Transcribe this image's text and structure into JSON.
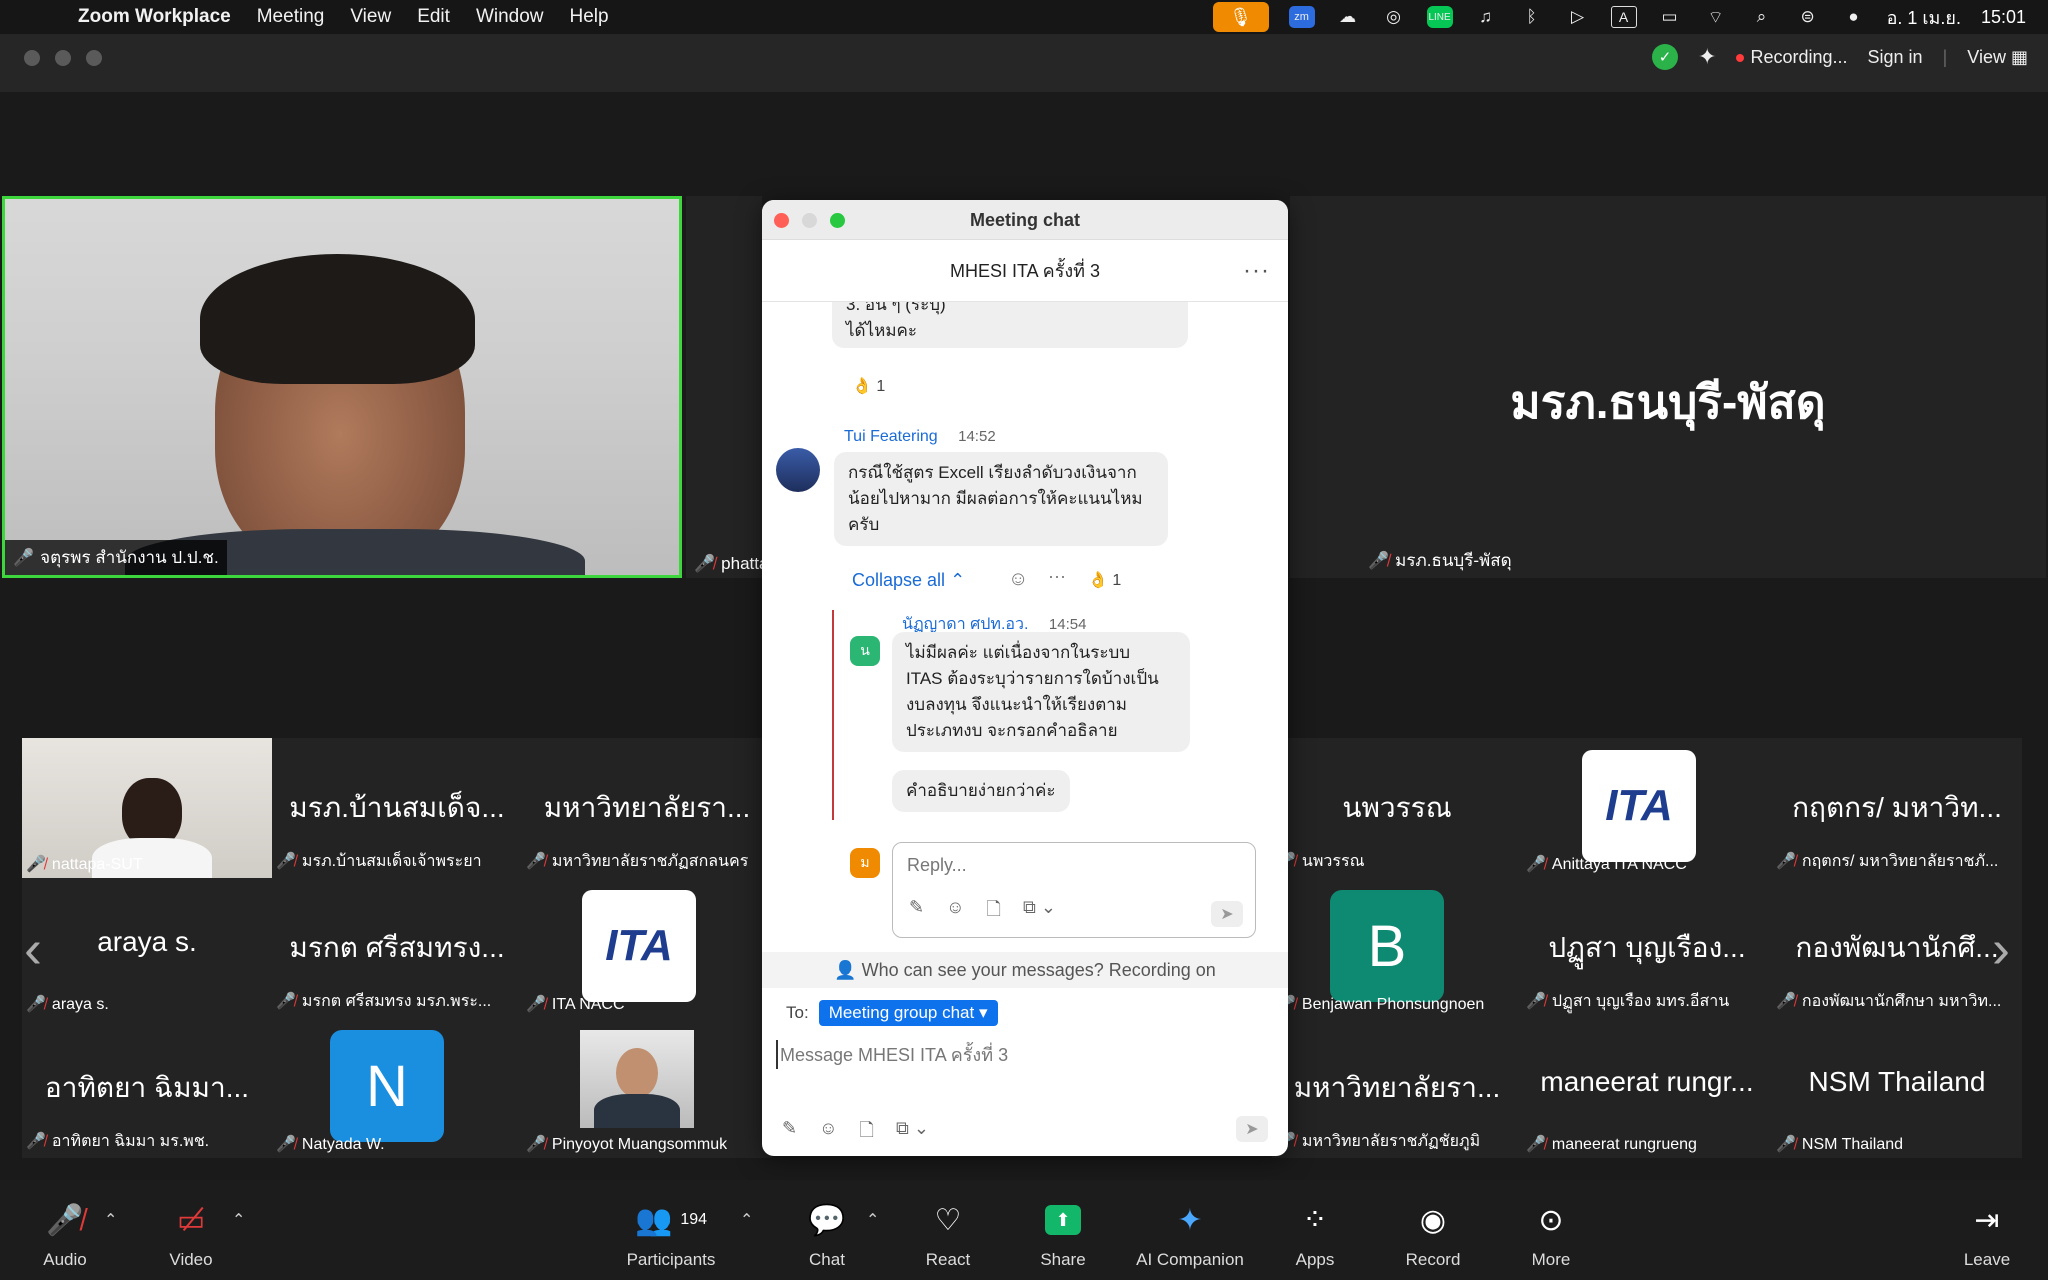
{
  "menubar": {
    "app": "Zoom Workplace",
    "items": [
      "Meeting",
      "View",
      "Edit",
      "Window",
      "Help"
    ],
    "date": "อ. 1 เม.ย.",
    "time": "15:01"
  },
  "titlebar": {
    "recording": "Recording...",
    "sign_in": "Sign in",
    "view": "View"
  },
  "main_video": {
    "name": "จตุรพร สำนักงาน ป.ป.ช."
  },
  "big_tiles": [
    {
      "name": "phatta",
      "center": ""
    },
    {
      "name": "มรภ.ธนบุรี-พัสดุ",
      "center": "มรภ.ธนบุรี-พัสดุ"
    }
  ],
  "grid": {
    "row1": [
      {
        "center": "",
        "name": "nattapa-SUT",
        "kind": "photo-woman"
      },
      {
        "center": "มรภ.บ้านสมเด็จ...",
        "name": "มรภ.บ้านสมเด็จเจ้าพระยา"
      },
      {
        "center": "มหาวิทยาลัยรา...",
        "name": "มหาวิทยาลัยราชภัฏสกลนคร"
      },
      {
        "center": "นพวรรณ",
        "name": "นพวรรณ"
      },
      {
        "center": "",
        "name": "Anittaya ITA NACC",
        "kind": "ita"
      },
      {
        "center": "กฤตกร/ มหาวิท...",
        "name": "กฤตกร/ มหาวิทยาลัยราชภั..."
      }
    ],
    "row2": [
      {
        "center": "araya s.",
        "name": "araya s."
      },
      {
        "center": "มรกต ศรีสมทรง...",
        "name": "มรกต ศรีสมทรง มรภ.พระ..."
      },
      {
        "center": "",
        "name": "ITA NACC",
        "kind": "ita"
      },
      {
        "center": "",
        "name": "Benjawan Phonsungnoen",
        "kind": "avatar",
        "letter": "B",
        "color": "#0f8a72"
      },
      {
        "center": "ปฏูสา บุญเรือง...",
        "name": "ปฏูสา บุญเรือง มทร.อีสาน"
      },
      {
        "center": "กองพัฒนานักศึ...",
        "name": "กองพัฒนานักศึกษา มหาวิท..."
      }
    ],
    "row3": [
      {
        "center": "อาทิตยา ฉิมมา...",
        "name": "อาทิตยา ฉิมมา มร.พช."
      },
      {
        "center": "",
        "name": "Natyada W.",
        "kind": "avatar",
        "letter": "N",
        "color": "#1a8fe0"
      },
      {
        "center": "",
        "name": "Pinyoyot Muangsommuk",
        "kind": "photo-man"
      },
      {
        "center": "มหาวิทยาลัยรา...",
        "name": "มหาวิทยาลัยราชภัฏชัยภูมิ"
      },
      {
        "center": "maneerat rungr...",
        "name": "maneerat rungrueng"
      },
      {
        "center": "NSM Thailand",
        "name": "NSM Thailand"
      }
    ],
    "ita_logo_text": "ITA"
  },
  "chat": {
    "window_title": "Meeting chat",
    "meeting_name": "MHESI ITA ครั้งที่ 3",
    "msg0_partial": "3.  อื่น ๆ (ระบุ)",
    "msg0_tail": "ได้ไหมคะ",
    "msg0_reaction": "👌 1",
    "msg1": {
      "sender": "Tui Featering",
      "time": "14:52",
      "line1": "กรณีใช้สูตร Excell เรียงลำดับวงเงินจาก",
      "line2": "น้อยไปหามาก มีผลต่อการให้คะแนนไหม",
      "line3": "ครับ"
    },
    "collapse_label": "Collapse all",
    "msg1_reaction": "👌 1",
    "reply1": {
      "sender": "นัฏญาดา ศปท.อว.",
      "time": "14:54",
      "avatar_letter": "น",
      "line1": "ไม่มีผลค่ะ แต่เนื่องจากในระบบ",
      "line2": "ITAS ต้องระบุว่ารายการใดบ้างเป็น",
      "line3": "งบลงทุน จึงแนะนำให้เรียงตาม",
      "line4": "ประเภทงบ จะกรอกคำอธิลาย",
      "line5": "คำอธิบายง่ายกว่าค่ะ"
    },
    "reply_avatar_letter": "ม",
    "reply_placeholder": "Reply...",
    "who_can_see": "Who can see your messages? Recording on",
    "to_label": "To:",
    "to_value": "Meeting group chat",
    "message_placeholder": "Message MHESI ITA ครั้งที่ 3"
  },
  "toolbar": {
    "audio": "Audio",
    "video": "Video",
    "participants": "Participants",
    "participant_count": "194",
    "chat": "Chat",
    "react": "React",
    "share": "Share",
    "ai": "AI Companion",
    "apps": "Apps",
    "record": "Record",
    "more": "More",
    "leave": "Leave"
  }
}
